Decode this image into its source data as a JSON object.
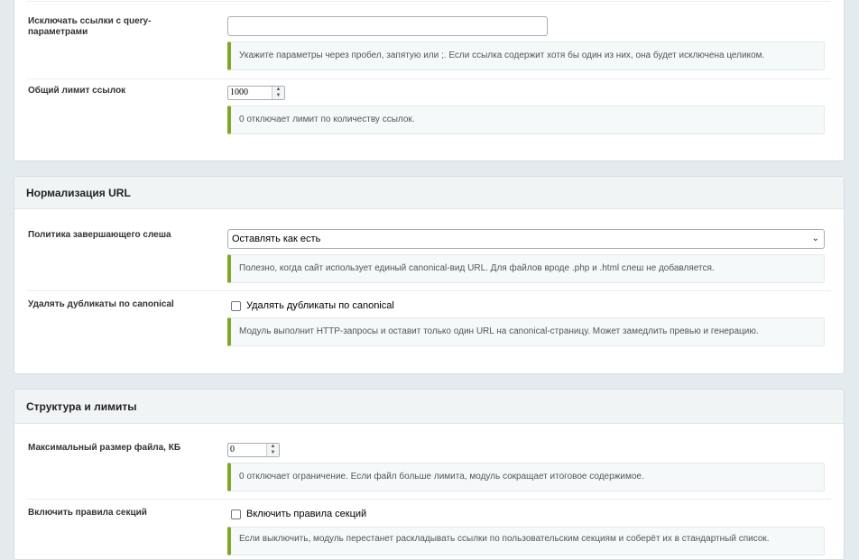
{
  "section_links": {
    "exclude_query": {
      "label": "Исключать ссылки с query-параметрами",
      "value": "",
      "hint": "Укажите параметры через пробел, запятую или ;. Если ссылка содержит хотя бы один из них, она будет исключена целиком."
    },
    "total_limit": {
      "label": "Общий лимит ссылок",
      "value": "1000",
      "hint": "0 отключает лимит по количеству ссылок."
    }
  },
  "section_url": {
    "title": "Нормализация URL",
    "trailing_slash": {
      "label": "Политика завершающего слеша",
      "selected": "Оставлять как есть",
      "hint": "Полезно, когда сайт использует единый canonical-вид URL. Для файлов вроде .php и .html слеш не добавляется."
    },
    "dedupe_canonical": {
      "label": "Удалять дубликаты по canonical",
      "checkbox_label": "Удалять дубликаты по canonical",
      "checked": false,
      "hint": "Модуль выполнит HTTP-запросы и оставит только один URL на canonical-страницу. Может замедлить превью и генерацию."
    }
  },
  "section_structure": {
    "title": "Структура и лимиты",
    "max_file_size": {
      "label": "Максимальный размер файла, КБ",
      "value": "0",
      "hint": "0 отключает ограничение. Если файл больше лимита, модуль сокращает итоговое содержимое."
    },
    "section_rules": {
      "label": "Включить правила секций",
      "checkbox_label": "Включить правила секций",
      "checked": false,
      "hint": "Если выключить, модуль перестанет раскладывать ссылки по пользовательским секциям и соберёт их в стандартный список."
    }
  },
  "icons": {
    "select_chevron": "chevron-down-icon",
    "spinner": "spinner-arrows-icon"
  },
  "colors": {
    "hint_accent": "#7ea72a",
    "page_bg": "#e4ebee",
    "panel_header_bg": "#f1f4f5"
  }
}
